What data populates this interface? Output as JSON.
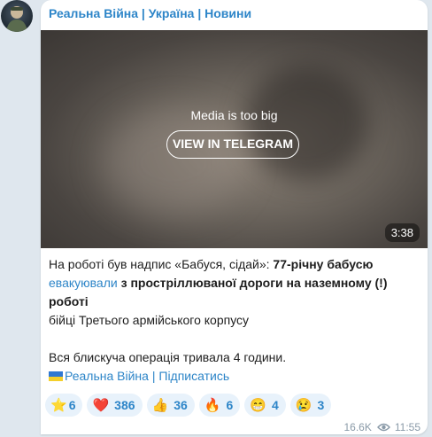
{
  "channel": {
    "name": "Реальна Війна | Україна | Новини"
  },
  "media": {
    "note": "Media is too big",
    "button_label": "VIEW IN TELEGRAM",
    "duration": "3:38"
  },
  "post": {
    "p1_a": "На роботі був надпис «Бабуся, сідай»: ",
    "p1_b": "77-річну бабусю",
    "p1_link": "евакуювали",
    "p1_c": " з простріллюваної дороги на наземному (!) роботі",
    "p1_d": "бійці Третього армійського корпусу",
    "p2": "Вся блискуча операція тривала 4 години.",
    "subscribe_left": "Реальна Війна",
    "subscribe_sep": " | ",
    "subscribe_right": "Підписатись"
  },
  "reactions": [
    {
      "icon": "star-icon",
      "emoji": "⭐",
      "count": "6"
    },
    {
      "icon": "heart-icon",
      "emoji": "❤️",
      "count": "386"
    },
    {
      "icon": "thumbs-up-icon",
      "emoji": "👍",
      "count": "36"
    },
    {
      "icon": "fire-icon",
      "emoji": "🔥",
      "count": "6"
    },
    {
      "icon": "grin-icon",
      "emoji": "😁",
      "count": "4"
    },
    {
      "icon": "crying-icon",
      "emoji": "😢",
      "count": "3"
    }
  ],
  "meta": {
    "views": "16.6K",
    "time": "11:55"
  },
  "colors": {
    "accent": "#2d85c8",
    "background": "#dfe7ee",
    "reaction_bg": "#e8f2fb"
  }
}
